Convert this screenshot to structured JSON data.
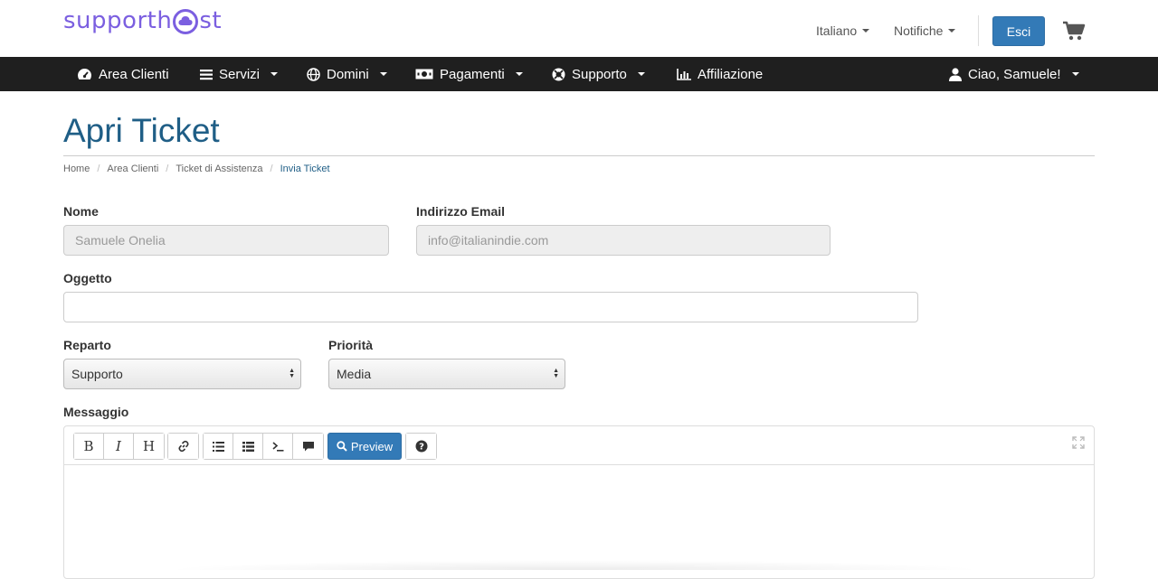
{
  "header": {
    "logo_left": "supporth",
    "logo_right": "st",
    "language_label": "Italiano",
    "notifications_label": "Notifiche",
    "logout_label": "Esci"
  },
  "nav": {
    "items": [
      {
        "label": "Area Clienti",
        "icon": "dashboard-icon"
      },
      {
        "label": "Servizi",
        "icon": "list-icon"
      },
      {
        "label": "Domini",
        "icon": "globe-icon"
      },
      {
        "label": "Pagamenti",
        "icon": "money-icon"
      },
      {
        "label": "Supporto",
        "icon": "lifebuoy-icon"
      },
      {
        "label": "Affiliazione",
        "icon": "chart-icon"
      }
    ],
    "user_label": "Ciao, Samuele!"
  },
  "page": {
    "title": "Apri Ticket",
    "breadcrumb": [
      "Home",
      "Area Clienti",
      "Ticket di Assistenza",
      "Invia Ticket"
    ]
  },
  "form": {
    "name_label": "Nome",
    "name_value": "Samuele Onelia",
    "email_label": "Indirizzo Email",
    "email_value": "info@italianindie.com",
    "subject_label": "Oggetto",
    "subject_value": "",
    "department_label": "Reparto",
    "department_value": "Supporto",
    "priority_label": "Priorità",
    "priority_value": "Media",
    "message_label": "Messaggio",
    "preview_label": "Preview"
  },
  "colors": {
    "brand": "#7b5fe0",
    "primary": "#337ab7",
    "navbar": "#1f1f1f",
    "title": "#1f5e86"
  }
}
